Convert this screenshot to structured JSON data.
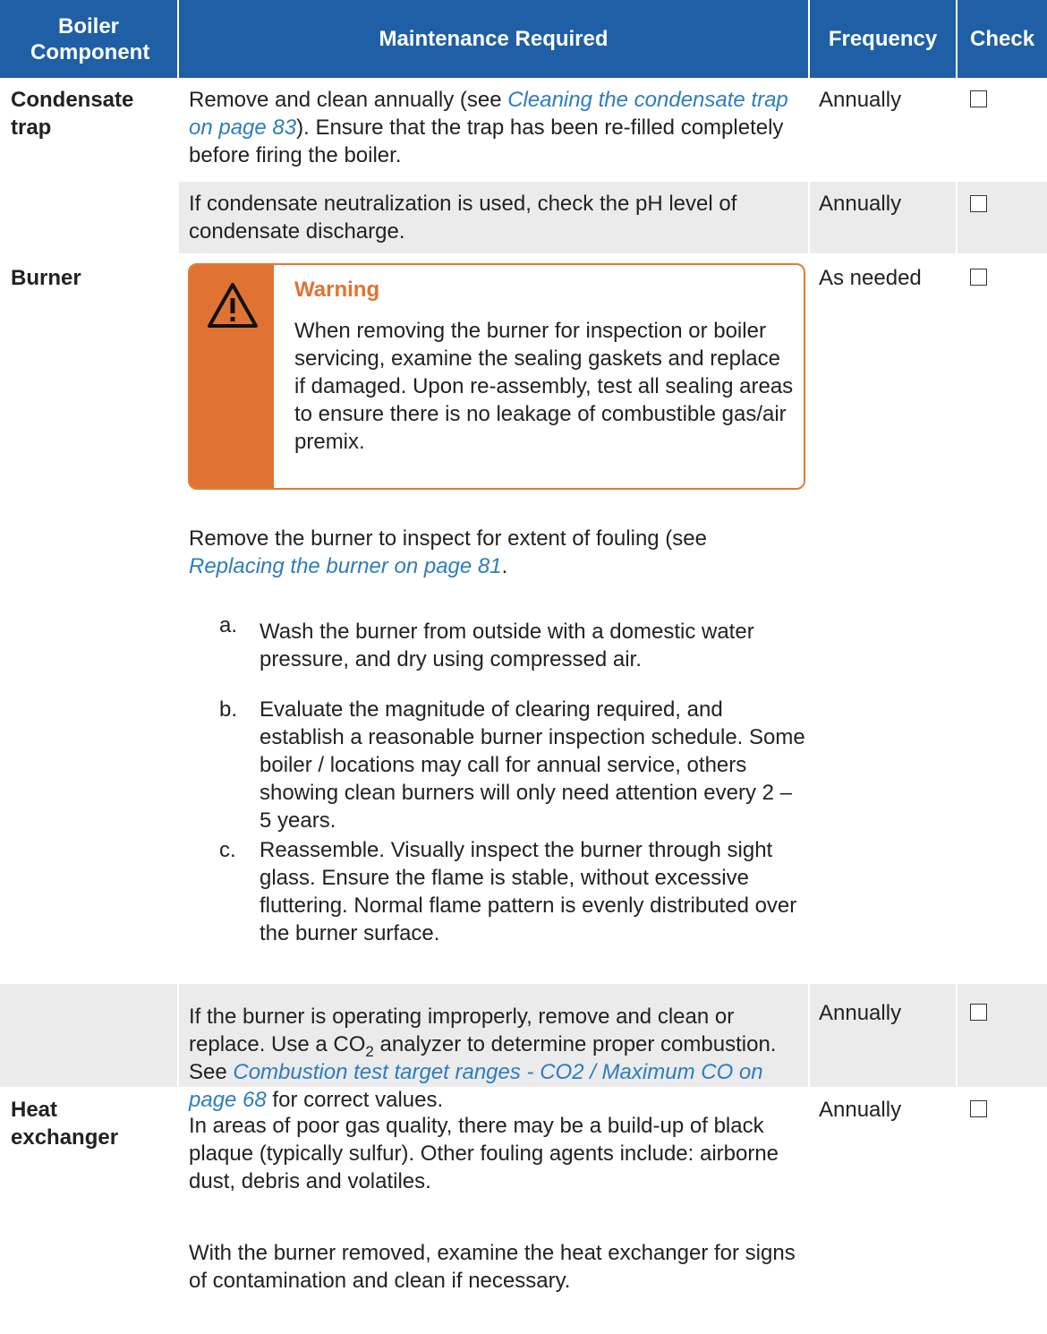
{
  "table": {
    "headers": {
      "component": "Boiler Component",
      "maintenance": "Maintenance Required",
      "frequency": "Frequency",
      "check": "Check"
    },
    "header_color": "#1f5fa6",
    "shade_color": "#ebebeb"
  },
  "rows": {
    "condensate": {
      "component": "Condensate trap",
      "text_before": "Remove and clean annually (see ",
      "link": "Cleaning the condensate trap on page 83",
      "text_after": "). Ensure that the trap has been re-filled completely before firing the boiler.",
      "frequency": "Annually",
      "check": false
    },
    "neutralization": {
      "text": "If condensate neutralization is used, check the pH level of condensate discharge.",
      "frequency": "Annually",
      "check": false
    },
    "burner": {
      "component": "Burner",
      "frequency": "As needed",
      "check": false,
      "warning": {
        "title": "Warning",
        "icon": "warning-triangle-icon",
        "color": "#e07333",
        "text": "When removing the burner for inspection or boiler servicing, examine the sealing gaskets and replace if damaged. Upon re-assembly, test all sealing areas to ensure there is no leakage of combustible gas/air premix."
      },
      "intro_before": "Remove the burner to inspect for extent of fouling (see ",
      "intro_link": "Replacing the burner  on page 81",
      "intro_after": ".",
      "steps": [
        {
          "marker": "a.",
          "text": "Wash the burner from outside with a domestic water pressure, and dry using compressed air."
        },
        {
          "marker": "b.",
          "text": "Evaluate the magnitude of clearing required, and establish a reasonable burner inspection schedule. Some boiler / locations may call for annual service, others showing clean burners will only need attention every 2 – 5 years."
        },
        {
          "marker": "c.",
          "text": "Reassemble. Visually inspect the burner through sight glass. Ensure the flame is stable, without excessive fluttering. Normal flame pattern is evenly distributed over the burner surface."
        }
      ]
    },
    "burner_improper": {
      "text_1": "If the burner is operating improperly, remove and clean or replace. Use a CO",
      "sub": "2",
      "text_2": " analyzer to determine proper combustion. See ",
      "link": "Combustion test target ranges - CO2 / Maximum CO on page 68",
      "text_3": " for correct values.",
      "frequency": "Annually",
      "check": false
    },
    "heat_exchanger": {
      "component": "Heat exchanger",
      "para1": "In areas of poor gas quality, there may be a build-up of black plaque (typically sulfur). Other fouling agents include: airborne dust, debris and volatiles.",
      "para2": "With the burner removed, examine the heat exchanger for signs of contamination and clean if necessary.",
      "frequency": "Annually",
      "check": false
    }
  }
}
